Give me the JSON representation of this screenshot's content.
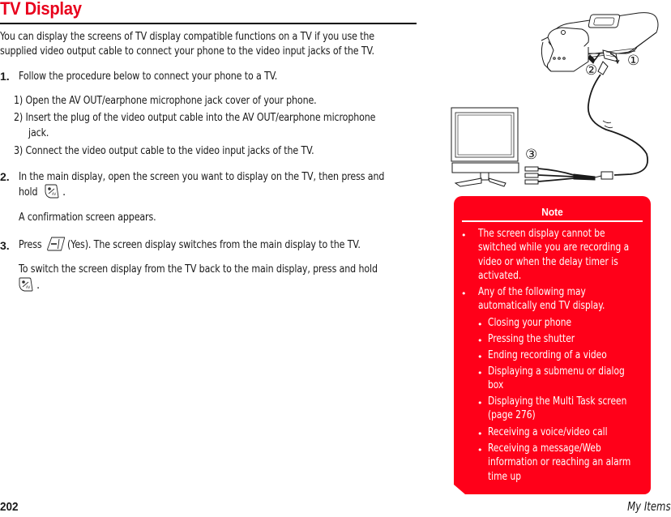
{
  "page": {
    "title": "TV Display",
    "intro": [
      "You can display the screens of TV display compatible functions on a TV if you use the",
      "supplied video output cable to connect your phone to the video input jacks of the TV."
    ],
    "steps": [
      {
        "number": "1.",
        "text": "Follow the procedure below to connect your phone to a TV.",
        "substeps": [
          {
            "number": "1)",
            "lines": [
              "Open the AV OUT/earphone microphone jack cover of your phone."
            ]
          },
          {
            "number": "2)",
            "lines": [
              "Insert the plug of the video output cable into the AV OUT/earphone microphone",
              "jack."
            ]
          },
          {
            "number": "3)",
            "lines": [
              "Connect the video output cable to the video input jacks of the TV."
            ]
          }
        ]
      },
      {
        "number": "2.",
        "lines": [
          "In the main display, open the screen you want to display on the TV, then press and",
          "hold"
        ],
        "key_icon": "tv-display-key-icon",
        "trailing": ".",
        "result": "A confirmation screen appears."
      },
      {
        "number": "3.",
        "prefix": "Press",
        "key_icon": "soft-key-minus-icon",
        "suffix": "(Yes). The screen display switches from the main display to the TV.",
        "tip_lines": [
          "To switch the screen display from the TV back to the main display, press and hold"
        ],
        "tip_key_icon": "tv-display-key-icon",
        "tip_trailing": "."
      }
    ]
  },
  "illustration": {
    "labels": [
      "①",
      "②",
      "③"
    ],
    "description": "Phone connected via video output cable to TV"
  },
  "note": {
    "title": "Note",
    "color": "#ff0019",
    "items": [
      {
        "lines": [
          "The screen display cannot be",
          "switched while you are recording a",
          "video or when the delay timer is",
          "activated."
        ]
      },
      {
        "lines": [
          "Any of the following may",
          "automatically end TV display."
        ],
        "subitems": [
          {
            "lines": [
              "Closing your phone"
            ]
          },
          {
            "lines": [
              "Pressing the shutter"
            ]
          },
          {
            "lines": [
              "Ending recording of a video"
            ]
          },
          {
            "lines": [
              "Displaying a submenu or dialog",
              "box"
            ]
          },
          {
            "lines": [
              "Displaying the Multi Task screen",
              "(page 276)"
            ]
          },
          {
            "lines": [
              "Receiving a voice/video call"
            ]
          },
          {
            "lines": [
              "Receiving a message/Web",
              "information or reaching an alarm",
              "time up"
            ]
          }
        ]
      }
    ]
  },
  "footer": {
    "page_number": "202",
    "section": "My Items"
  },
  "colors": {
    "title": "#e8001c",
    "note_bg": "#ff0019"
  }
}
